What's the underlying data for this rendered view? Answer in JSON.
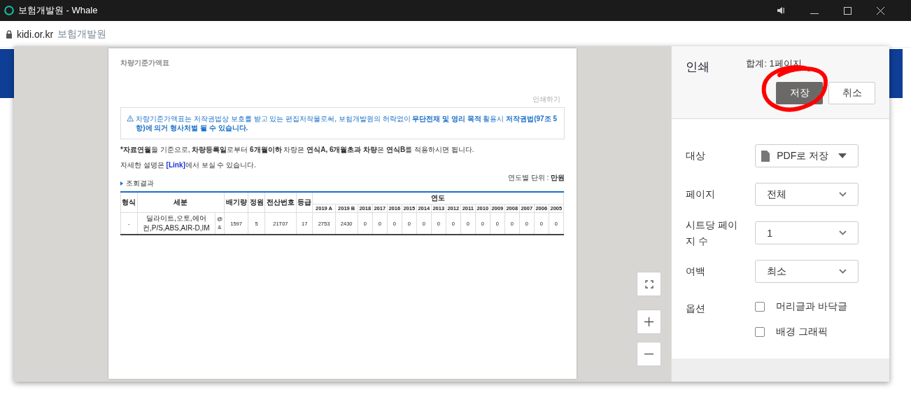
{
  "window": {
    "title": "보험개발원 - Whale"
  },
  "address_bar": {
    "domain": "kidi.or.kr",
    "site_name": "보험개발원"
  },
  "preview": {
    "page_title": "차량기준가액표",
    "print_link": "인쇄하기",
    "notice": "차량기준가액표는 저작권법상 보호를 받고 있는 편집저작물로써, 보험개발원의 허락없이 **무단전재 및 영리 목적** 활용시 **저작권법(97조 5항)에 의거 형사처벌 될 수 있습니다.**",
    "note_mark": "*",
    "note": "**자료연월**을 기준으로, **차량등록일**로부터 **6개월이하** 차량은 **연식A, 6개월초과 차량**은 **연식B**를 적용하시면 됩니다.",
    "detail_before": "자세한 설명은 ",
    "detail_link": "[Link]",
    "detail_after": "에서 보실 수 있습니다.",
    "unit": "연도별 단위 : **만원**",
    "section_title": "조회결과",
    "table": {
      "columns": [
        {
          "label": "형식"
        },
        {
          "label": "세분",
          "colspan": 2
        },
        {
          "label": "배기량"
        },
        {
          "label": "정원"
        },
        {
          "label": "전산번호"
        },
        {
          "label": "등급"
        }
      ],
      "year_group": "연도",
      "years": [
        "2019 A",
        "2019 B",
        "2018",
        "2017",
        "2016",
        "2015",
        "2014",
        "2013",
        "2012",
        "2011",
        "2010",
        "2009",
        "2008",
        "2007",
        "2006",
        "2005"
      ],
      "rows": [
        {
          "cells": [
            "-",
            "딜라이트,오토,에어컨,P/S,ABS,AIR-D,IM",
            "@&",
            "1597",
            "5",
            "21T07",
            "17"
          ],
          "values": [
            "2753",
            "2430",
            "0",
            "0",
            "0",
            "0",
            "0",
            "0",
            "0",
            "0",
            "0",
            "0",
            "0",
            "0",
            "0",
            "0"
          ]
        }
      ]
    }
  },
  "print_dialog": {
    "title": "인쇄",
    "total": "합계: 1페이지",
    "buttons": [
      {
        "label": "저장",
        "kind": "primary"
      },
      {
        "label": "취소",
        "kind": "secondary"
      }
    ],
    "settings": [
      {
        "label": "대상",
        "value": "PDF로 저장",
        "kind": "destination"
      },
      {
        "label": "페이지",
        "value": "전체",
        "kind": "select"
      },
      {
        "label": "시트당 페이지 수",
        "value": "1",
        "kind": "select"
      },
      {
        "label": "여백",
        "value": "최소",
        "kind": "select"
      }
    ],
    "options_label": "옵션",
    "options": [
      {
        "label": "머리글과 바닥글",
        "checked": false
      },
      {
        "label": "배경 그래픽",
        "checked": false
      }
    ]
  }
}
